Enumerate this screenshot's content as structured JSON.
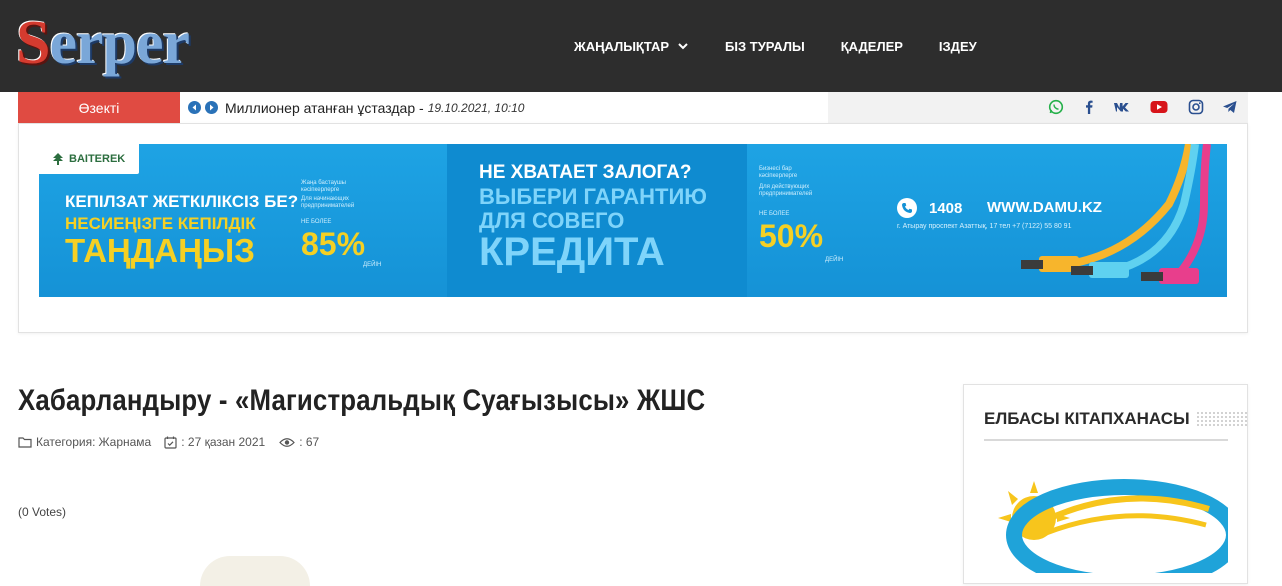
{
  "header": {
    "logo": "Serper",
    "nav": [
      {
        "label": "ЖАҢАЛЫҚТАР",
        "has_dropdown": true
      },
      {
        "label": "БІЗ ТУРАЛЫ",
        "has_dropdown": false
      },
      {
        "label": "ҚАДЕЛЕР",
        "has_dropdown": false
      },
      {
        "label": "ІЗДЕУ",
        "has_dropdown": false
      }
    ]
  },
  "ticker": {
    "label": "Өзекті",
    "headline": "Миллионер атанған ұстаздар -",
    "date": "19.10.2021, 10:10",
    "social_icons": [
      "whatsapp-icon",
      "facebook-icon",
      "vk-icon",
      "youtube-icon",
      "instagram-icon",
      "telegram-icon"
    ]
  },
  "banner": {
    "brand": "BAITEREK",
    "kz_line1": "КЕПІЛЗАТ ЖЕТКІЛІКСІЗ БЕ?",
    "kz_line2": "НЕСИЕҢІЗГЕ КЕПІЛДІК",
    "kz_line3": "ТАҢДАҢЫЗ",
    "kz_small1": "Жаңа бастаушы кәсіпкерлерге",
    "kz_small2": "Для начинающих предпринимателей",
    "kz_limit": "НЕ БОЛЕЕ",
    "kz_pct": "85%",
    "kz_pct_note": "ДЕЙІН",
    "ru_line1": "НЕ ХВАТАЕТ ЗАЛОГА?",
    "ru_line2": "ВЫБЕРИ ГАРАНТИЮ",
    "ru_line3": "ДЛЯ СОВЕГО",
    "ru_line4": "КРЕДИТА",
    "ru_small1": "Бизнесі бар кәсіпкерлерге",
    "ru_small2": "Для действующих предпринимателей",
    "ru_limit": "НЕ БОЛЕЕ",
    "ru_pct": "50%",
    "ru_pct_note": "ДЕЙІН",
    "phone": "1408",
    "site": "WWW.DAMU.KZ",
    "address": "г. Атырау проспект Азаттық, 17 тел +7 (7122) 55 80 91"
  },
  "article": {
    "title": "Хабарландыру - «Магистральдық Суағызысы» ЖШС",
    "category_label": "Категория:",
    "category_value": "Жарнама",
    "date": ": 27 қазан 2021",
    "views": ": 67",
    "votes": "(0 Votes)"
  },
  "sidebar": {
    "title": "ЕЛБАСЫ КІТАПХАНАСЫ"
  }
}
